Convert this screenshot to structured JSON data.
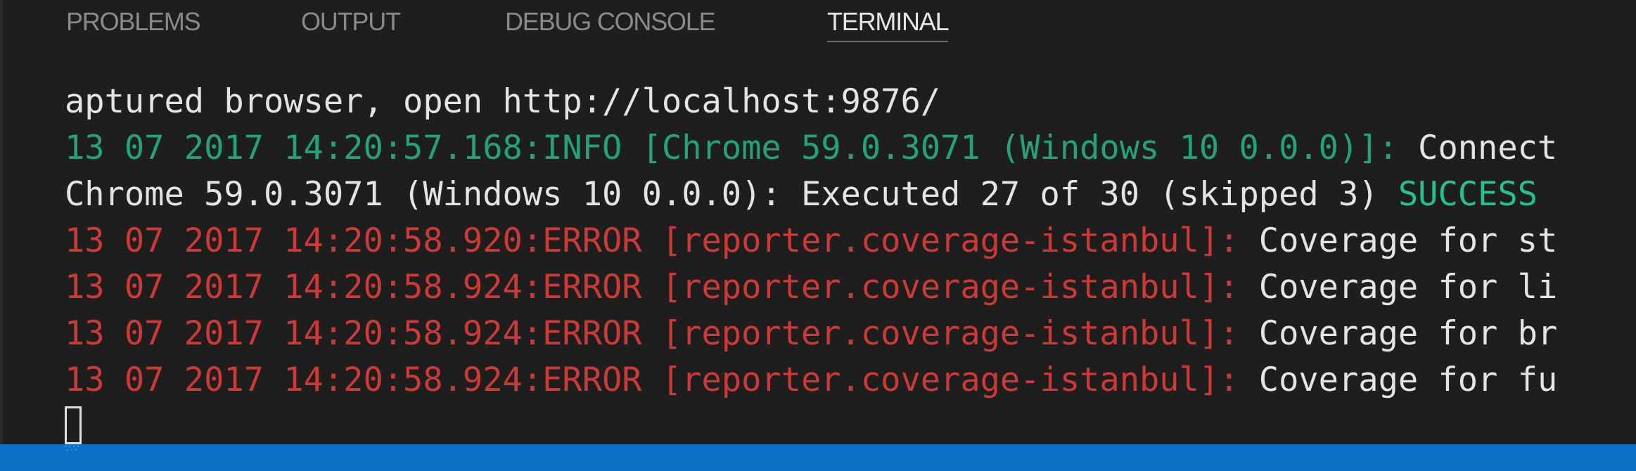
{
  "tabs": [
    {
      "label": "PROBLEMS"
    },
    {
      "label": "OUTPUT"
    },
    {
      "label": "DEBUG CONSOLE"
    },
    {
      "label": "TERMINAL"
    }
  ],
  "active_tab": "TERMINAL",
  "terminal": {
    "lines": [
      {
        "segments": [
          {
            "text": "aptured browser, open http://localhost:9876/",
            "color": "#e4e4e4"
          }
        ]
      },
      {
        "segments": [
          {
            "text": "13 07 2017 14:20:57.168:INFO [Chrome 59.0.3071 (Windows 10 0.0.0)]:",
            "color": "#23a37c"
          },
          {
            "text": " Connect",
            "color": "#e4e4e4"
          }
        ]
      },
      {
        "segments": [
          {
            "text": "Chrome 59.0.3071 (Windows 10 0.0.0): Executed 27 of 30 (skipped 3) ",
            "color": "#e4e4e4"
          },
          {
            "text": "SUCCESS",
            "color": "#25c28a"
          }
        ]
      },
      {
        "segments": [
          {
            "text": "13 07 2017 14:20:58.920:ERROR [reporter.coverage-istanbul]:",
            "color": "#cd3a35"
          },
          {
            "text": " Coverage for st",
            "color": "#e4e4e4"
          }
        ]
      },
      {
        "segments": [
          {
            "text": "13 07 2017 14:20:58.924:ERROR [reporter.coverage-istanbul]:",
            "color": "#cd3a35"
          },
          {
            "text": " Coverage for li",
            "color": "#e4e4e4"
          }
        ]
      },
      {
        "segments": [
          {
            "text": "13 07 2017 14:20:58.924:ERROR [reporter.coverage-istanbul]:",
            "color": "#cd3a35"
          },
          {
            "text": " Coverage for br",
            "color": "#e4e4e4"
          }
        ]
      },
      {
        "segments": [
          {
            "text": "13 07 2017 14:20:58.924:ERROR [reporter.coverage-istanbul]:",
            "color": "#cd3a35"
          },
          {
            "text": " Coverage for fu",
            "color": "#e4e4e4"
          }
        ]
      }
    ]
  },
  "colors": {
    "background": "#1e1e1e",
    "statusbar": "#0b72c8",
    "info": "#23a37c",
    "success": "#25c28a",
    "error": "#cd3a35",
    "text": "#e4e4e4"
  }
}
